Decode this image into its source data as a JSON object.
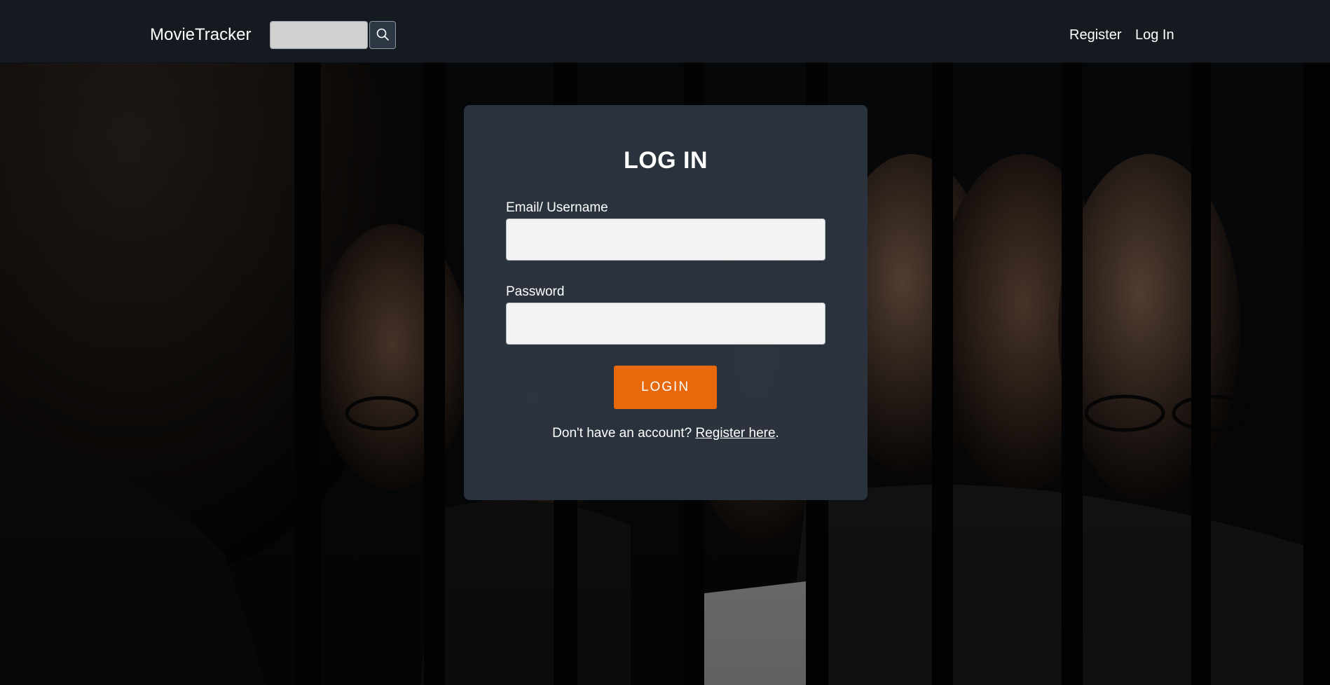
{
  "navbar": {
    "brand": "MovieTracker",
    "search": {
      "value": "",
      "placeholder": "",
      "button_icon": "search-icon"
    },
    "links": [
      {
        "label": "Register"
      },
      {
        "label": "Log In"
      }
    ]
  },
  "login": {
    "title": "LOG IN",
    "email_label": "Email/ Username",
    "email_value": "",
    "password_label": "Password",
    "password_value": "",
    "submit_label": "LOGIN",
    "register_prompt": "Don't have an account?",
    "register_link": "Register here",
    "register_suffix": "."
  },
  "colors": {
    "navbar_bg": "#151a21",
    "card_bg": "#2c3440",
    "accent": "#e8680c",
    "text": "#ffffff"
  }
}
